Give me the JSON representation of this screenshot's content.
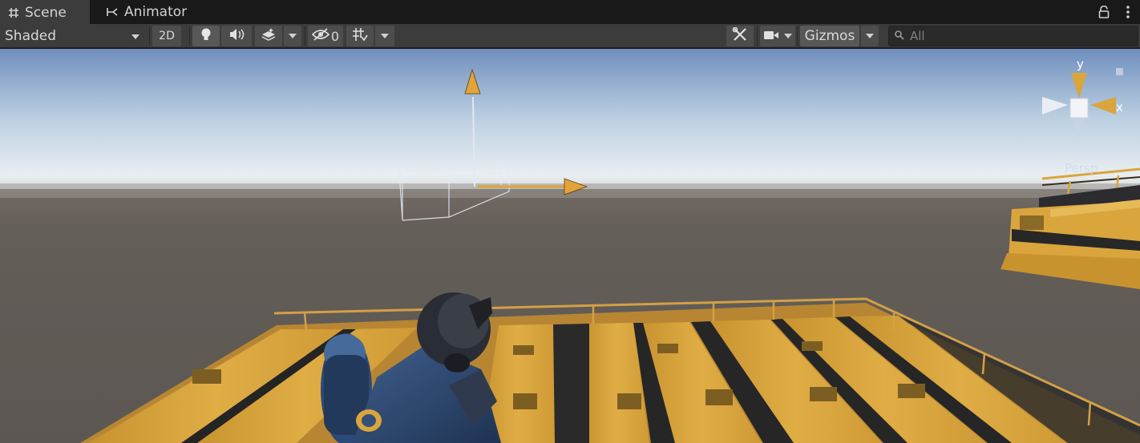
{
  "tabs": [
    {
      "label": "Scene",
      "icon": "grid-hash-icon",
      "active": true
    },
    {
      "label": "Animator",
      "icon": "animator-flow-icon",
      "active": false
    }
  ],
  "window_controls": {
    "lock_icon": "lock-icon",
    "menu_icon": "more-vertical-icon"
  },
  "toolbar": {
    "draw_mode": "Shaded",
    "mode_2d": "2D",
    "hidden_count": "0",
    "gizmos_label": "Gizmos",
    "search_placeholder": "All",
    "icons": {
      "lighting": "lightbulb-icon",
      "audio": "audio-speaker-icon",
      "effects": "effects-layers-icon",
      "visibility": "eye-slash-icon",
      "grid": "grid-snap-icon",
      "tools": "tools-wrench-icon",
      "camera": "camera-icon",
      "search": "search-icon"
    }
  },
  "viewport": {
    "projection_label": "Persp",
    "orientation_gizmo": {
      "y_label": "y",
      "x_label": "x"
    },
    "colors": {
      "sky_top": "#6f8fbe",
      "horizon": "#e9eef2",
      "ground": "#5f5a55",
      "axis_handle": "#e2a33a",
      "platform": "#d9a53c"
    }
  }
}
